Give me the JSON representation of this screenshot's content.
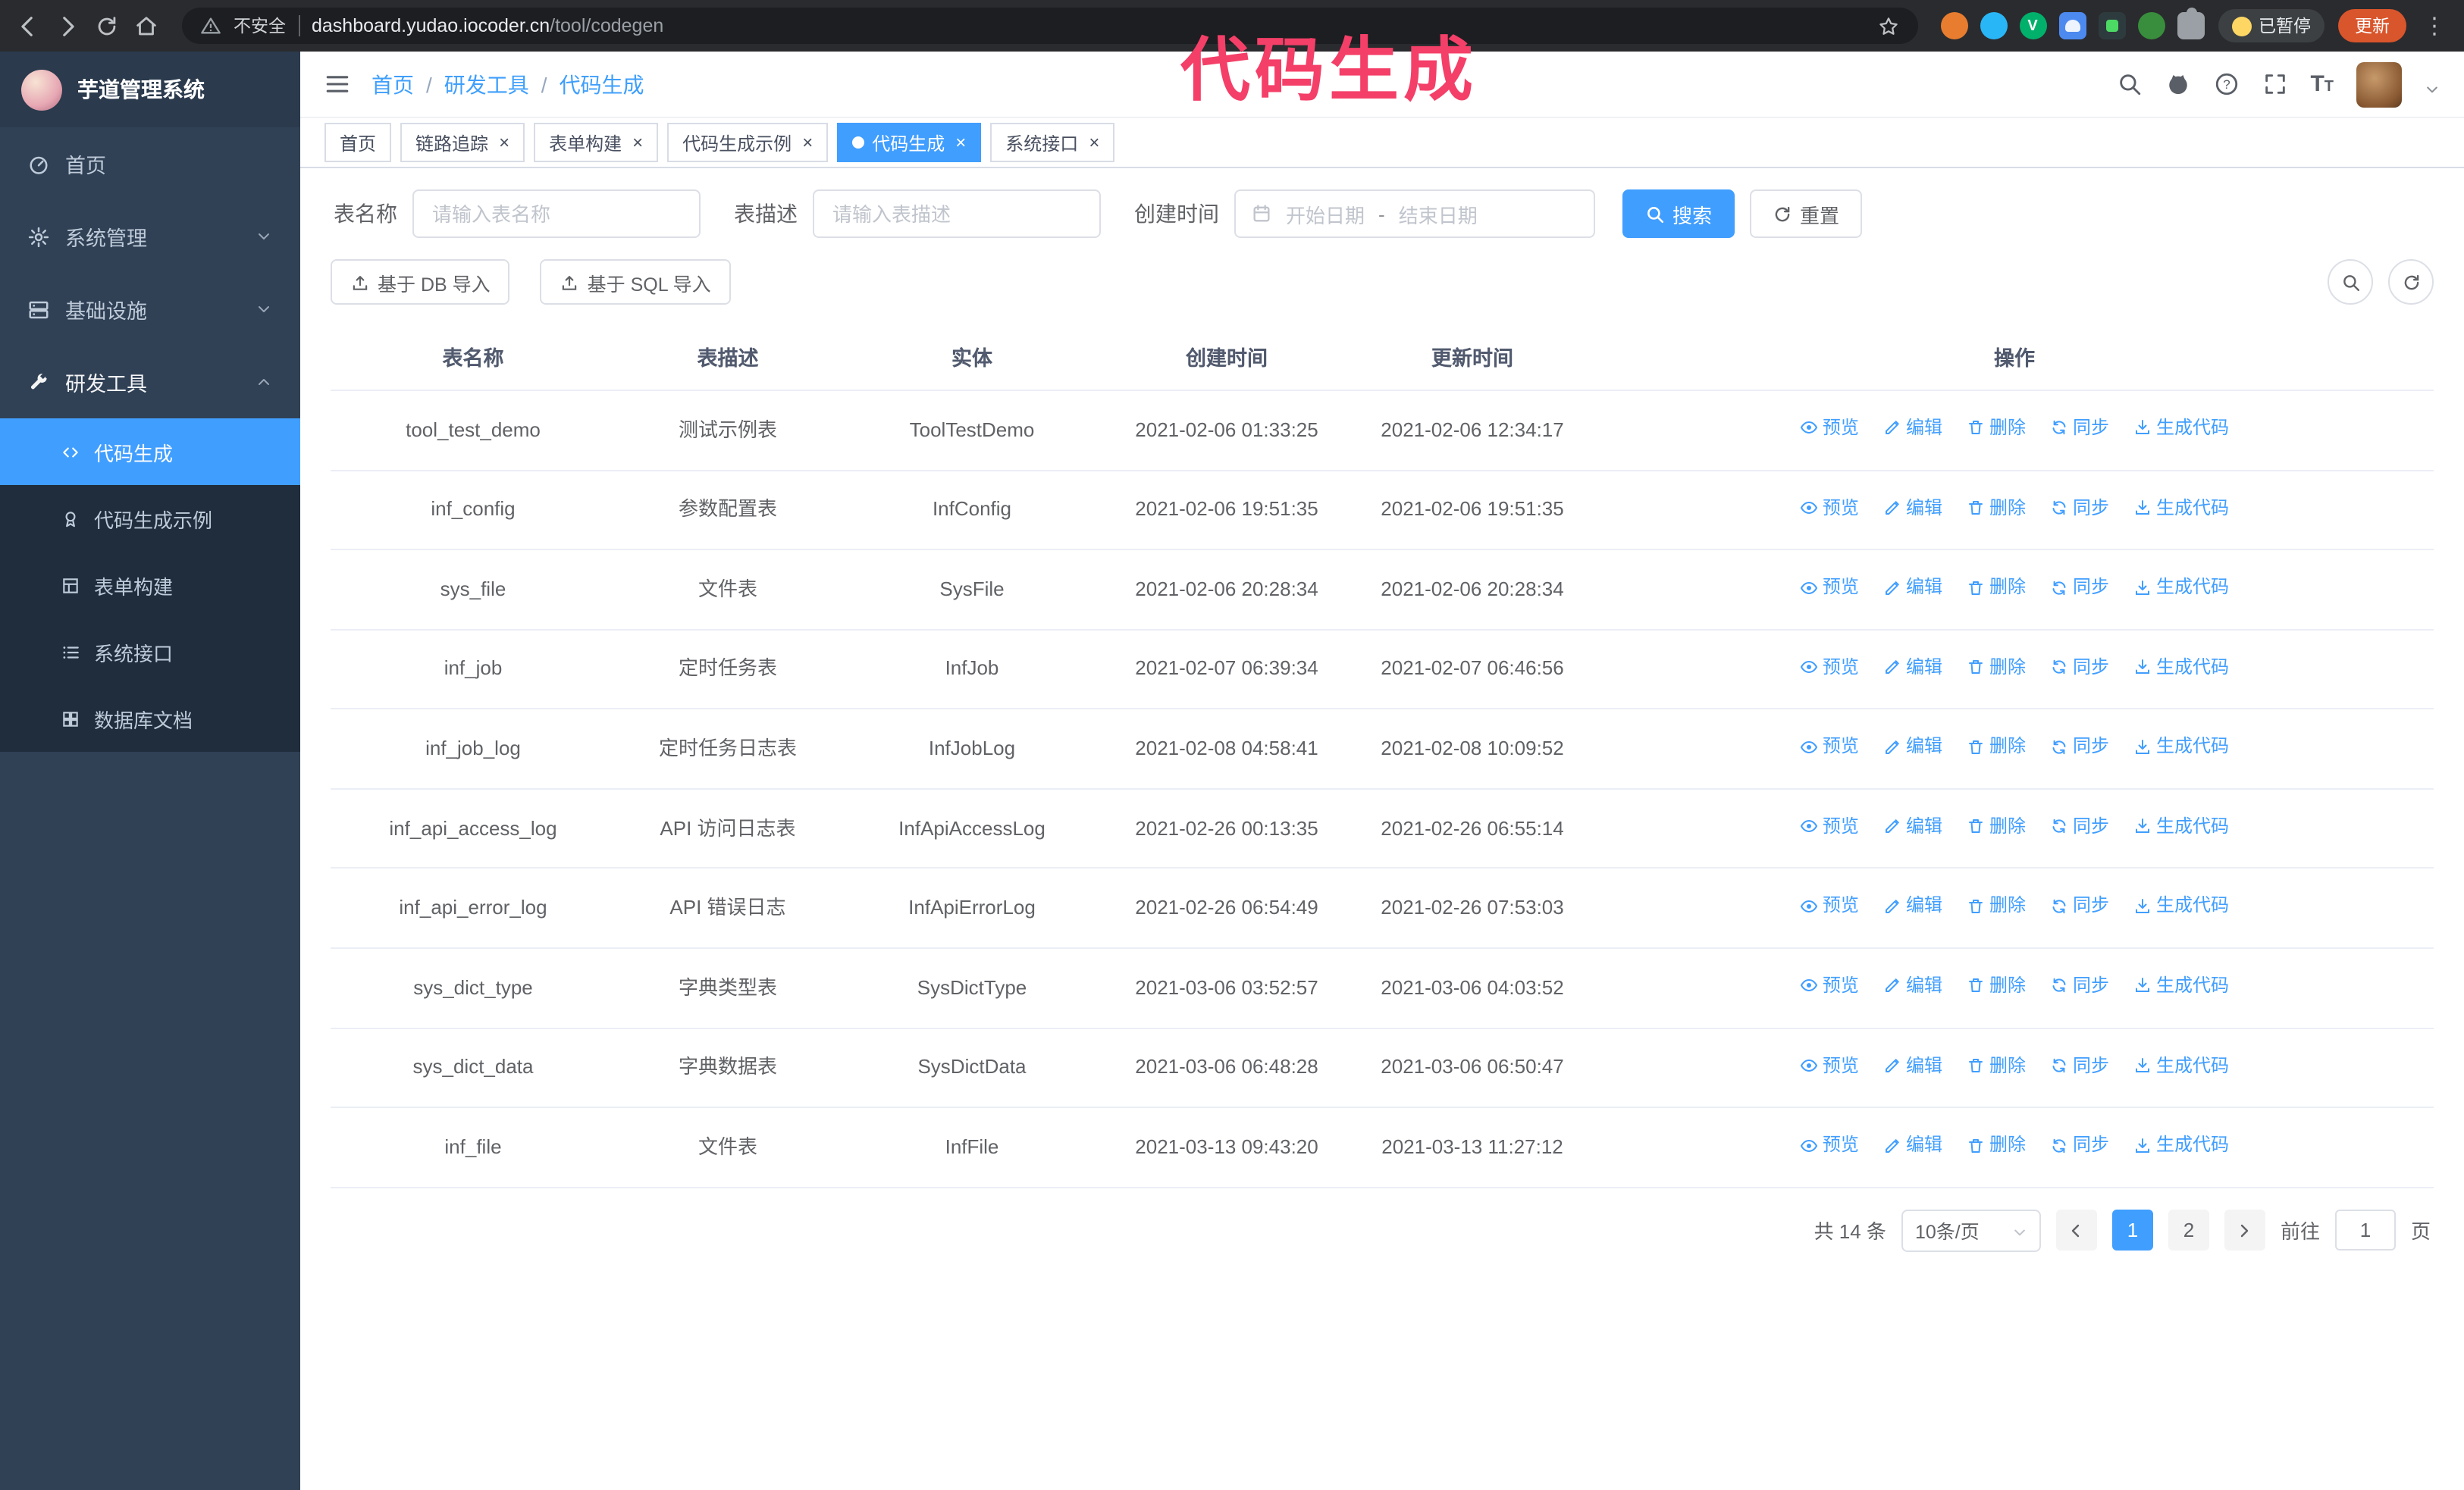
{
  "theme": {
    "accent": "#409eff",
    "sidebar_bg": "#304156",
    "annotation_color": "#f43f68"
  },
  "annotation": {
    "text": "代码生成"
  },
  "browser": {
    "security_label": "不安全",
    "url_domain": "dashboard.yudao.iocoder.cn",
    "url_path": "/tool/codegen",
    "paused_chip": "已暂停",
    "update_chip": "更新"
  },
  "sidebar": {
    "logo_title": "芋道管理系统",
    "items": [
      {
        "label": "首页"
      },
      {
        "label": "系统管理"
      },
      {
        "label": "基础设施"
      },
      {
        "label": "研发工具"
      }
    ],
    "submenu": [
      {
        "label": "代码生成"
      },
      {
        "label": "代码生成示例"
      },
      {
        "label": "表单构建"
      },
      {
        "label": "系统接口"
      },
      {
        "label": "数据库文档"
      }
    ]
  },
  "breadcrumb": {
    "items": [
      "首页",
      "研发工具",
      "代码生成"
    ],
    "separator": "/"
  },
  "tabs": [
    {
      "label": "首页"
    },
    {
      "label": "链路追踪"
    },
    {
      "label": "表单构建"
    },
    {
      "label": "代码生成示例"
    },
    {
      "label": "代码生成"
    },
    {
      "label": "系统接口"
    }
  ],
  "filters": {
    "table_name_label": "表名称",
    "table_name_placeholder": "请输入表名称",
    "table_desc_label": "表描述",
    "table_desc_placeholder": "请输入表描述",
    "create_time_label": "创建时间",
    "date_start_placeholder": "开始日期",
    "date_separator": "-",
    "date_end_placeholder": "结束日期",
    "search_button": "搜索",
    "reset_button": "重置"
  },
  "toolbar": {
    "import_db": "基于 DB 导入",
    "import_sql": "基于 SQL 导入"
  },
  "table": {
    "columns": [
      "表名称",
      "表描述",
      "实体",
      "创建时间",
      "更新时间",
      "操作"
    ],
    "actions": [
      "预览",
      "编辑",
      "删除",
      "同步",
      "生成代码"
    ],
    "rows": [
      {
        "name": "tool_test_demo",
        "desc": "测试示例表",
        "entity": "ToolTestDemo",
        "created": "2021-02-06 01:33:25",
        "updated": "2021-02-06 12:34:17"
      },
      {
        "name": "inf_config",
        "desc": "参数配置表",
        "entity": "InfConfig",
        "created": "2021-02-06 19:51:35",
        "updated": "2021-02-06 19:51:35"
      },
      {
        "name": "sys_file",
        "desc": "文件表",
        "entity": "SysFile",
        "created": "2021-02-06 20:28:34",
        "updated": "2021-02-06 20:28:34"
      },
      {
        "name": "inf_job",
        "desc": "定时任务表",
        "entity": "InfJob",
        "created": "2021-02-07 06:39:34",
        "updated": "2021-02-07 06:46:56"
      },
      {
        "name": "inf_job_log",
        "desc": "定时任务日志表",
        "entity": "InfJobLog",
        "created": "2021-02-08 04:58:41",
        "updated": "2021-02-08 10:09:52"
      },
      {
        "name": "inf_api_access_log",
        "desc": "API 访问日志表",
        "entity": "InfApiAccessLog",
        "created": "2021-02-26 00:13:35",
        "updated": "2021-02-26 06:55:14"
      },
      {
        "name": "inf_api_error_log",
        "desc": "API 错误日志",
        "entity": "InfApiErrorLog",
        "created": "2021-02-26 06:54:49",
        "updated": "2021-02-26 07:53:03"
      },
      {
        "name": "sys_dict_type",
        "desc": "字典类型表",
        "entity": "SysDictType",
        "created": "2021-03-06 03:52:57",
        "updated": "2021-03-06 04:03:52"
      },
      {
        "name": "sys_dict_data",
        "desc": "字典数据表",
        "entity": "SysDictData",
        "created": "2021-03-06 06:48:28",
        "updated": "2021-03-06 06:50:47"
      },
      {
        "name": "inf_file",
        "desc": "文件表",
        "entity": "InfFile",
        "created": "2021-03-13 09:43:20",
        "updated": "2021-03-13 11:27:12"
      }
    ]
  },
  "pagination": {
    "total": "共 14 条",
    "page_size": "10条/页",
    "pages": [
      "1",
      "2"
    ],
    "goto_label": "前往",
    "goto_value": "1",
    "goto_suffix": "页"
  }
}
